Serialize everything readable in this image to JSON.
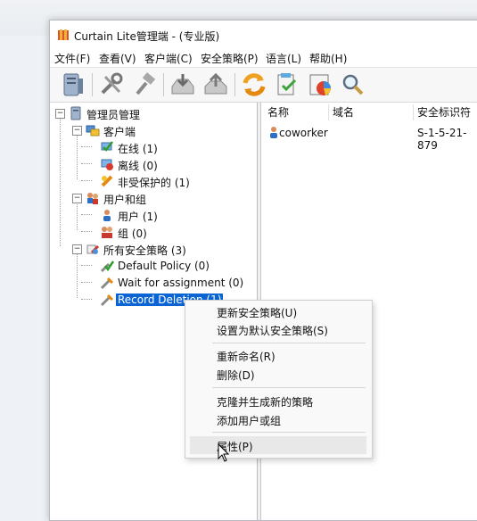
{
  "window": {
    "title": "Curtain Lite管理端 - (专业版)"
  },
  "menu": [
    "文件(F)",
    "查看(V)",
    "客户端(C)",
    "安全策略(P)",
    "语言(L)",
    "帮助(H)"
  ],
  "toolbar_icons": [
    "server-icon",
    "tools-icon",
    "hammer-icon",
    "inbox-download-icon",
    "upload-icon",
    "refresh-icon",
    "document-check-icon",
    "report-icon",
    "search-icon"
  ],
  "tree": {
    "root": "管理员管理",
    "clients": "客户端",
    "online": "在线 (1)",
    "offline": "离线 (0)",
    "unprotected": "非受保护的 (1)",
    "users_groups": "用户和组",
    "users": "用户 (1)",
    "groups": "组 (0)",
    "policies": "所有安全策略 (3)",
    "default_policy": "Default Policy (0)",
    "wait_policy": "Wait for assignment (0)",
    "record_policy": "Record Deletion (1)"
  },
  "list": {
    "columns": [
      "名称",
      "域名",
      "安全标识符"
    ],
    "rows": [
      {
        "name": "coworker",
        "domain": "",
        "sid": "S-1-5-21-879"
      }
    ]
  },
  "context_menu": {
    "update_policy": "更新安全策略(U)",
    "set_default": "设置为默认安全策略(S)",
    "rename": "重新命名(R)",
    "delete": "删除(D)",
    "clone": "克隆并生成新的策略",
    "add_user_group": "添加用户或组",
    "properties": "属性(P)"
  }
}
